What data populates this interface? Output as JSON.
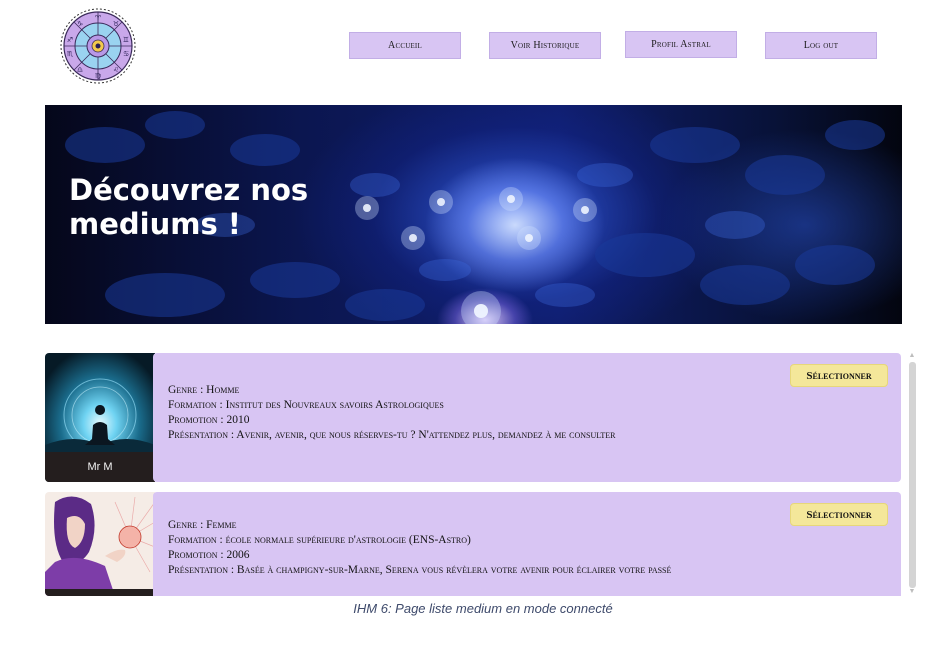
{
  "nav": {
    "accueil": "Accueil",
    "historique": "Voir Historique",
    "profil": "Profil Astral",
    "logout": "Log out"
  },
  "banner": {
    "title": "Découvrez nos mediums !"
  },
  "mediums": [
    {
      "name": "Mr M",
      "genre": "Genre : Homme",
      "formation": "Formation : Institut des Nouvreaux savoirs Astrologiques",
      "promotion": "Promotion : 2010",
      "presentation": "Présentation : Avenir, avenir, que nous réserves-tu ? N'attendez plus, demandez à me consulter",
      "button": "Sélectionner"
    },
    {
      "name": "",
      "genre": "Genre : Femme",
      "formation": "Formation : école normale supérieure d'astrologie (ENS-Astro)",
      "promotion": "Promotion : 2006",
      "presentation": "Présentation : Basée à champigny-sur-Marne, Serena vous révèlera votre avenir pour éclairer votre passé",
      "button": "Sélectionner"
    }
  ],
  "caption": "IHM 6: Page liste medium en mode connecté",
  "colors": {
    "nav_bg": "#d8c5f3",
    "card_bg": "#d8c5f3",
    "button_bg": "#f4e79a",
    "caption": "#3e4a6b"
  }
}
